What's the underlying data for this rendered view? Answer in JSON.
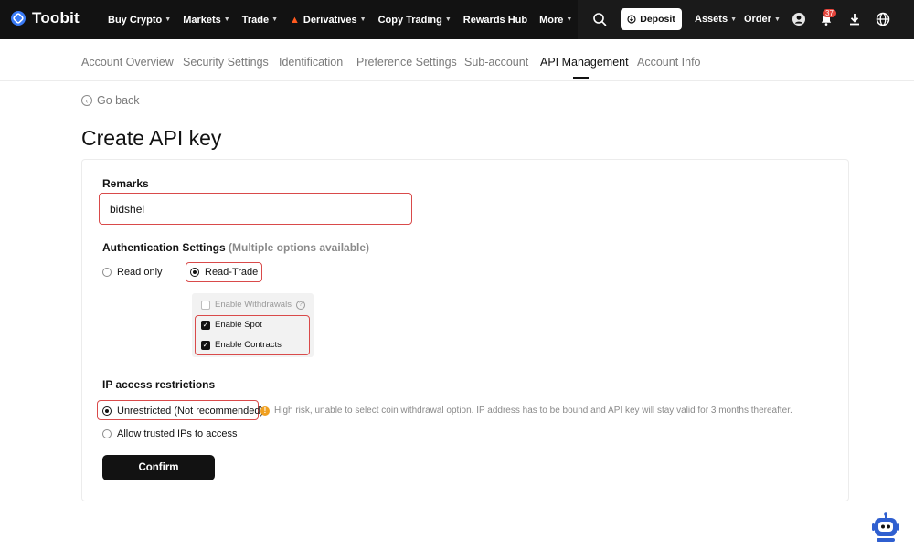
{
  "brand": {
    "name": "Toobit"
  },
  "nav": {
    "items": [
      {
        "label": "Buy Crypto",
        "caret": true
      },
      {
        "label": "Markets",
        "caret": true
      },
      {
        "label": "Trade",
        "caret": true
      },
      {
        "label": "Derivatives",
        "caret": true,
        "fire": true
      },
      {
        "label": "Copy Trading",
        "caret": true
      },
      {
        "label": "Rewards Hub",
        "caret": false
      },
      {
        "label": "More",
        "caret": true
      }
    ],
    "deposit_label": "Deposit",
    "assets_label": "Assets",
    "order_label": "Order",
    "notification_count": "37"
  },
  "subtabs": [
    {
      "label": "Account Overview",
      "active": false
    },
    {
      "label": "Security Settings",
      "active": false
    },
    {
      "label": "Identification",
      "active": false
    },
    {
      "label": "Preference Settings",
      "active": false
    },
    {
      "label": "Sub-account",
      "active": false
    },
    {
      "label": "API Management",
      "active": true
    },
    {
      "label": "Account Info",
      "active": false
    }
  ],
  "page": {
    "go_back": "Go back",
    "title": "Create API key"
  },
  "form": {
    "remarks_label": "Remarks",
    "remarks_value": "bidshel",
    "auth_label": "Authentication Settings",
    "auth_hint": "(Multiple options available)",
    "auth_options": [
      {
        "label": "Read only",
        "selected": false
      },
      {
        "label": "Read-Trade",
        "selected": true
      }
    ],
    "permissions": [
      {
        "label": "Enable Withdrawals",
        "checked": false,
        "disabled": true
      },
      {
        "label": "Enable Spot",
        "checked": true,
        "disabled": false
      },
      {
        "label": "Enable Contracts",
        "checked": true,
        "disabled": false
      }
    ],
    "ip_label": "IP access restrictions",
    "ip_options": [
      {
        "label": "Unrestricted (Not recommended)",
        "selected": true
      },
      {
        "label": "Allow trusted IPs to access",
        "selected": false
      }
    ],
    "ip_warning": "High risk, unable to select coin withdrawal option. IP address has to be bound and API key will stay valid for 3 months thereafter.",
    "confirm_label": "Confirm"
  },
  "colors": {
    "topbar": "#121212",
    "highlight": "#d94a4a",
    "warning": "#f0a020",
    "badge": "#e5443b"
  }
}
